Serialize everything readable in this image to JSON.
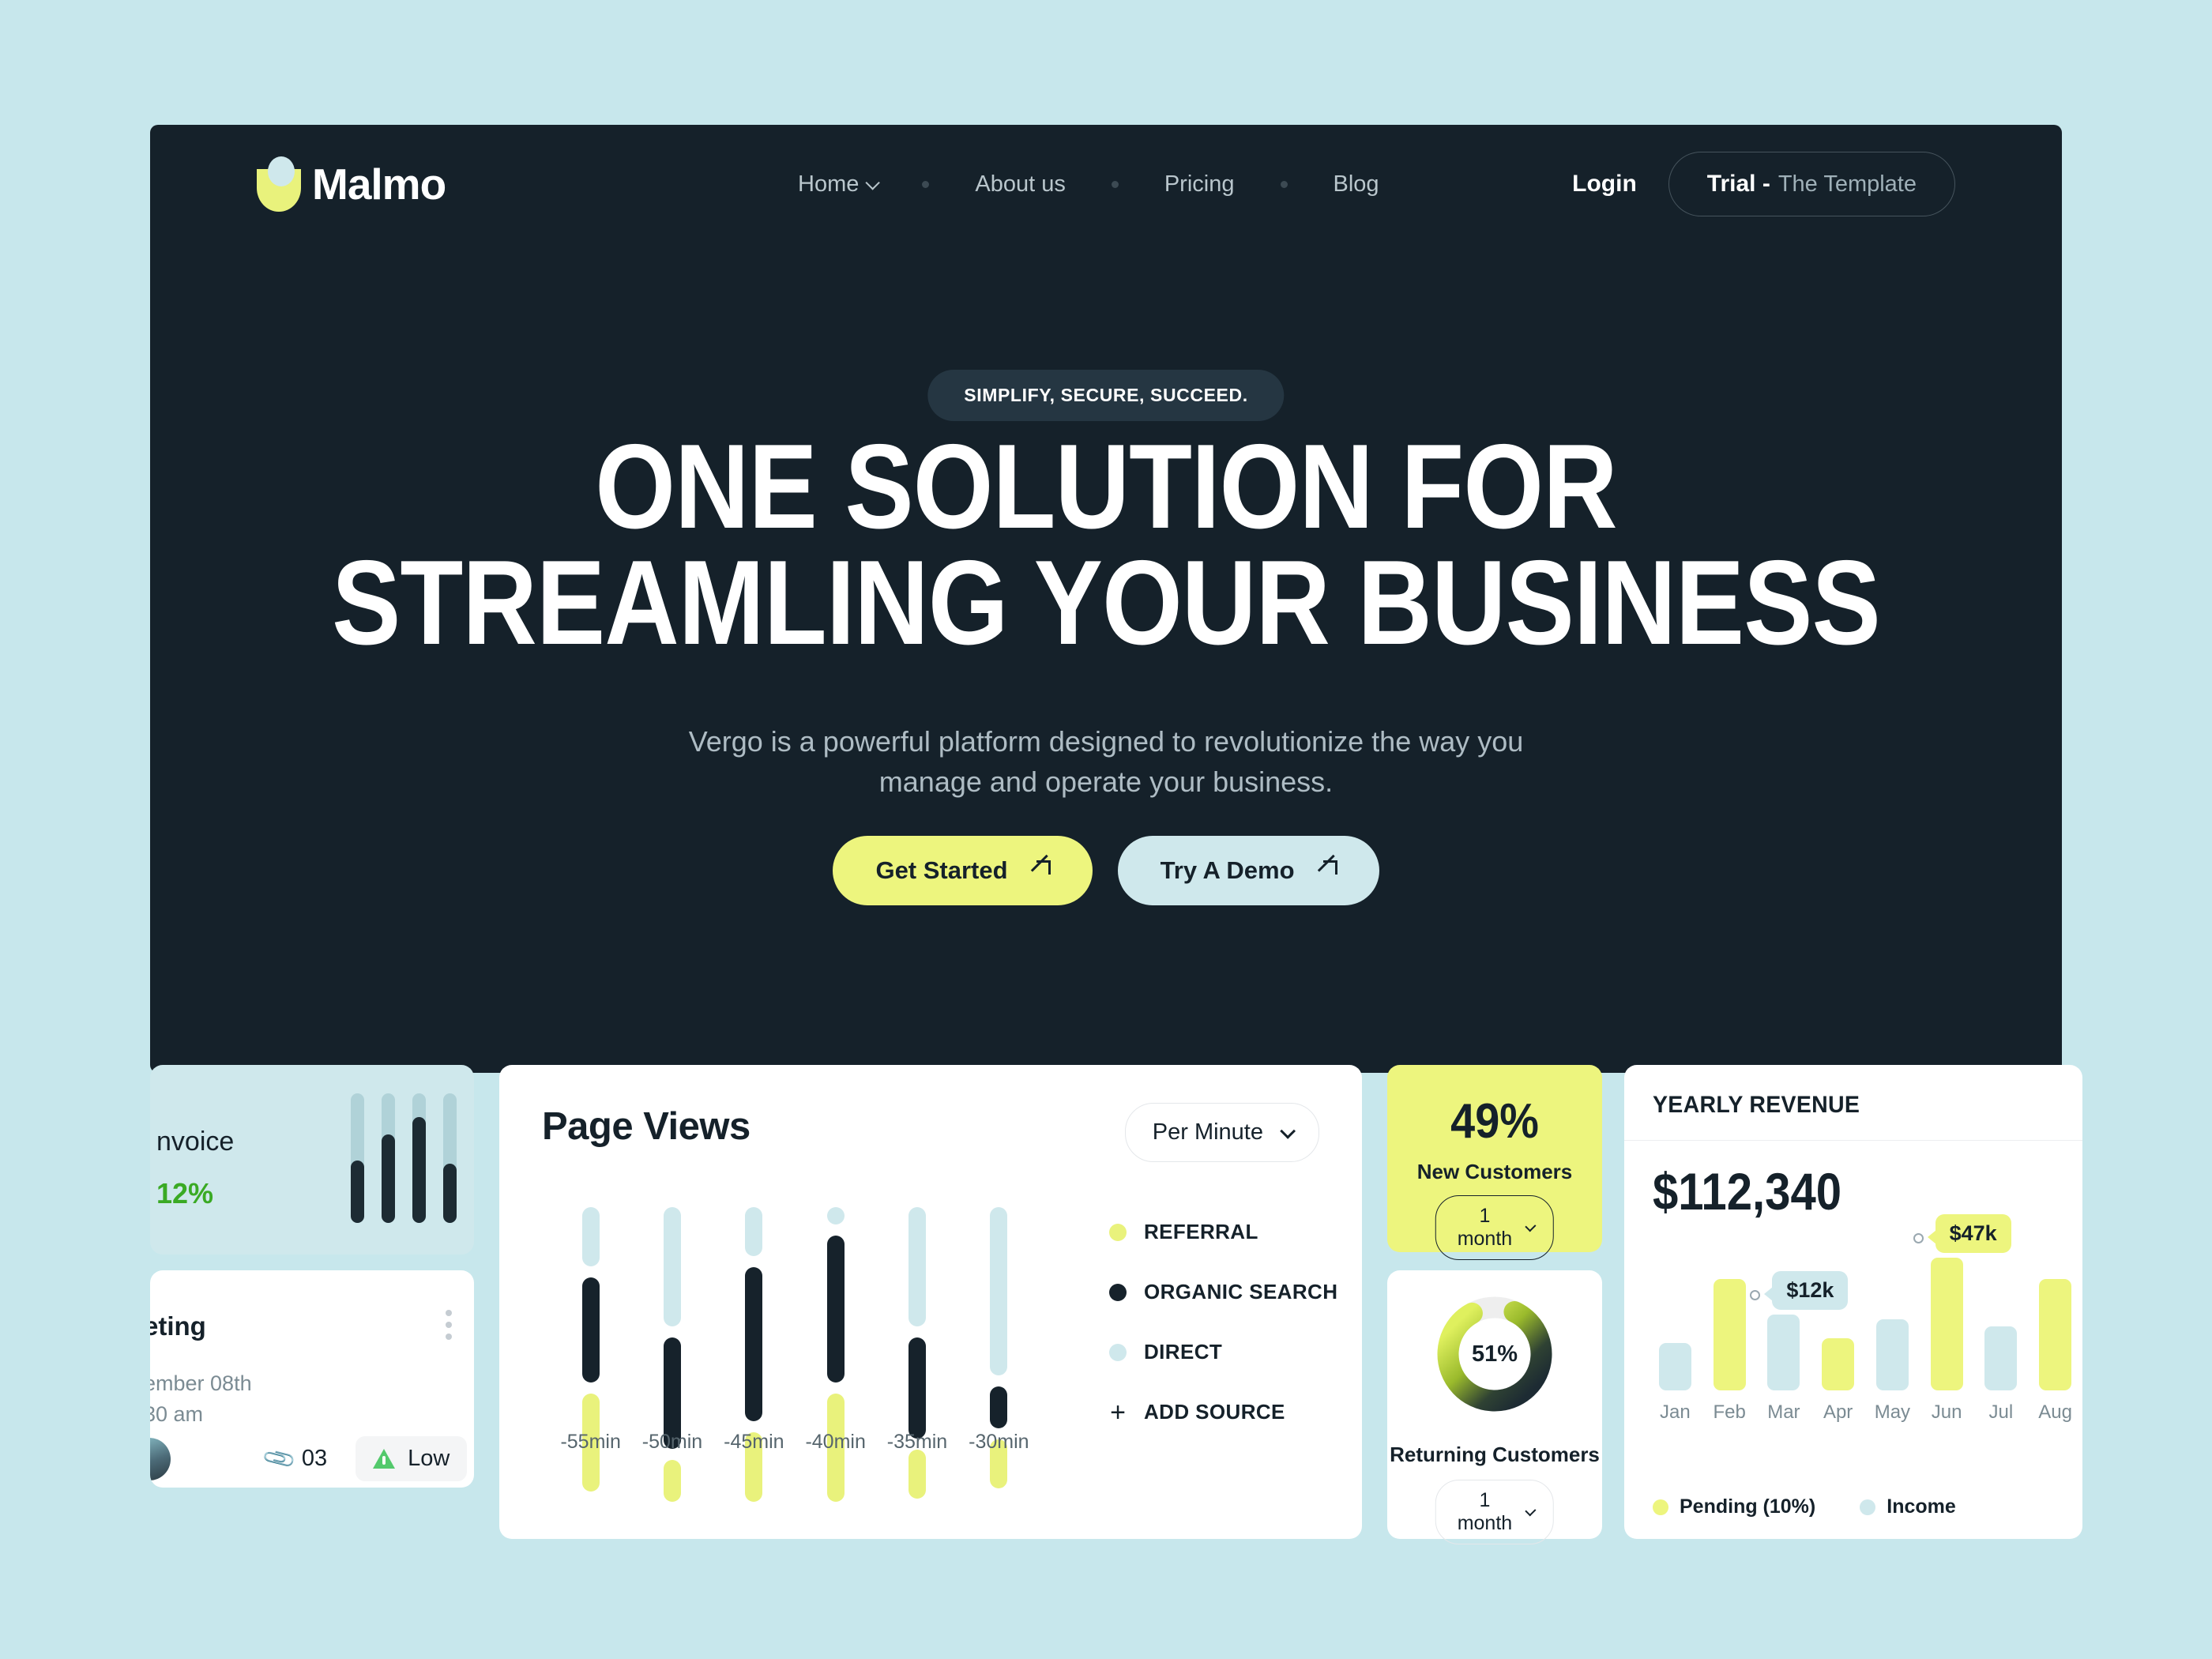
{
  "brand": {
    "name": "Malmo"
  },
  "nav": {
    "links": [
      {
        "label": "Home",
        "has_chevron": true
      },
      {
        "label": "About us",
        "has_chevron": false
      },
      {
        "label": "Pricing",
        "has_chevron": false
      },
      {
        "label": "Blog",
        "has_chevron": false
      }
    ],
    "login_label": "Login",
    "trial_strong": "Trial -",
    "trial_light": "The Template"
  },
  "hero": {
    "badge": "SIMPLIFY, SECURE, SUCCEED.",
    "title_line1": "ONE SOLUTION FOR",
    "title_line2": "STREAMLING YOUR BUSINESS",
    "subtitle": "Vergo is a powerful platform designed to revolutionize the way you manage and operate your business.",
    "cta_primary": "Get Started",
    "cta_secondary": "Try A Demo"
  },
  "invoice_card": {
    "title": "nvoice",
    "percent": "12%"
  },
  "meeting_card": {
    "title": "eting",
    "date_line1": "ember 08th",
    "date_line2": "30 am",
    "attachment_count": "03",
    "priority": "Low"
  },
  "page_views": {
    "title": "Page Views",
    "select_value": "Per Minute",
    "legend": [
      {
        "label": "REFERRAL",
        "color": "#e9f27c"
      },
      {
        "label": "ORGANIC SEARCH",
        "color": "#16222b"
      },
      {
        "label": "DIRECT",
        "color": "#cfe8ec"
      }
    ],
    "add_source_label": "ADD SOURCE"
  },
  "new_customers": {
    "value": "49%",
    "label": "New Customers",
    "select_value": "1 month"
  },
  "returning_customers": {
    "value": "51%",
    "label": "Returning Customers",
    "select_value": "1 month"
  },
  "yearly_revenue": {
    "title": "YEARLY REVENUE",
    "amount": "$112,340",
    "legend": [
      {
        "label": "Pending (10%)",
        "color": "#edf57e"
      },
      {
        "label": "Income",
        "color": "#cfe8ec"
      }
    ]
  },
  "colors": {
    "page_bg": "#c7e7ec",
    "panel_dark": "#15212a",
    "accent_yellow": "#edf57e",
    "accent_light_blue": "#cfe8ec",
    "green": "#3aaa24"
  },
  "chart_data": [
    {
      "type": "bar",
      "name": "page-views-stacked",
      "title": "Page Views",
      "xlabel": "",
      "ylabel": "",
      "categories": [
        "-55min",
        "-50min",
        "-45min",
        "-40min",
        "-35min",
        "-30min"
      ],
      "series": [
        {
          "name": "DIRECT",
          "color": "#cfe8ec",
          "values": [
            17,
            34,
            14,
            5,
            34,
            48
          ]
        },
        {
          "name": "ORGANIC SEARCH",
          "color": "#16222b",
          "values": [
            30,
            32,
            44,
            42,
            29,
            12
          ]
        },
        {
          "name": "REFERRAL",
          "color": "#e9f27c",
          "values": [
            28,
            12,
            20,
            31,
            14,
            14
          ]
        }
      ],
      "stacked": true,
      "legend_position": "right",
      "grid": false
    },
    {
      "type": "bar",
      "name": "yearly-revenue",
      "title": "YEARLY REVENUE",
      "total": "$112,340",
      "categories": [
        "Jan",
        "Feb",
        "Mar",
        "Apr",
        "May",
        "Jun",
        "Jul",
        "Aug"
      ],
      "values": [
        20,
        47,
        32,
        22,
        30,
        56,
        27,
        47
      ],
      "bar_colors": [
        "#cfe8ec",
        "#edf57e",
        "#cfe8ec",
        "#edf57e",
        "#cfe8ec",
        "#edf57e",
        "#cfe8ec",
        "#edf57e"
      ],
      "annotations": [
        {
          "category": "Mar",
          "label": "$12k",
          "bg": "#cfe8ec"
        },
        {
          "category": "Jun",
          "label": "$47k",
          "bg": "#edf57e"
        }
      ],
      "ylim": [
        0,
        60
      ],
      "grid": false,
      "legend_position": "bottom"
    },
    {
      "type": "pie",
      "name": "returning-customers-donut",
      "title": "Returning Customers",
      "center_label": "51%",
      "values": [
        51,
        49
      ],
      "labels": [
        "Returning",
        "Remaining"
      ]
    },
    {
      "type": "bar",
      "name": "invoice-mini-bars",
      "categories": [
        "1",
        "2",
        "3",
        "4"
      ],
      "values": [
        48,
        68,
        82,
        46
      ],
      "ylim": [
        0,
        100
      ]
    }
  ]
}
